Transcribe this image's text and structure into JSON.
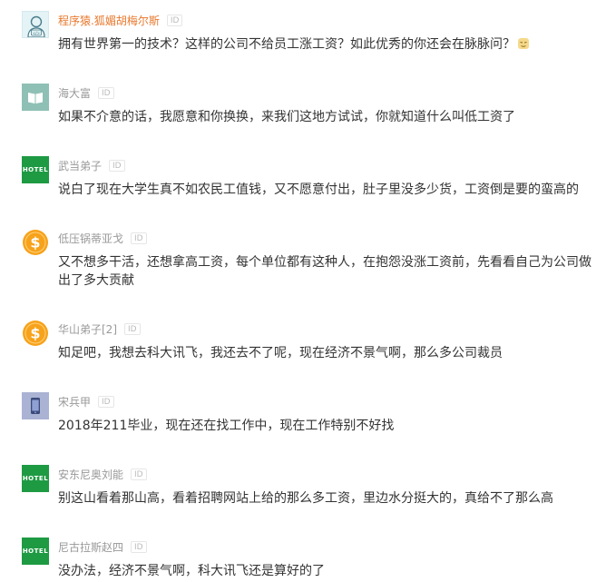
{
  "comments": [
    {
      "username": "程序猿.狐媚胡梅尔斯",
      "id_label": "ID",
      "avatar_icon": "coder-avatar-icon",
      "text": "拥有世界第一的技术？这样的公司不给员工涨工资？如此优秀的你还会在脉脉问？",
      "emoji_icon": "smug-emoji-icon"
    },
    {
      "username": "海大富",
      "id_label": "ID",
      "avatar_icon": "book-avatar-icon",
      "text": "如果不介意的话，我愿意和你换换，来我们这地方试试，你就知道什么叫低工资了"
    },
    {
      "username": "武当弟子",
      "id_label": "ID",
      "avatar_icon": "hotel-avatar-icon",
      "avatar_text": "HOTEL",
      "text": "说白了现在大学生真不如农民工值钱，又不愿意付出，肚子里没多少货，工资倒是要的蛮高的"
    },
    {
      "username": "低压锅蒂亚戈",
      "id_label": "ID",
      "avatar_icon": "dollar-coin-avatar-icon",
      "text": "又不想多干活，还想拿高工资，每个单位都有这种人，在抱怨没涨工资前，先看看自己为公司做出了多大贡献"
    },
    {
      "username": "华山弟子[2]",
      "id_label": "ID",
      "avatar_icon": "dollar-coin-avatar-icon",
      "text": "知足吧，我想去科大讯飞，我还去不了呢，现在经济不景气啊，那么多公司裁员"
    },
    {
      "username": "宋兵甲",
      "id_label": "ID",
      "avatar_icon": "phone-avatar-icon",
      "text": "2018年211毕业，现在还在找工作中，现在工作特别不好找"
    },
    {
      "username": "安东尼奥刘能",
      "id_label": "ID",
      "avatar_icon": "hotel-avatar-icon",
      "avatar_text": "HOTEL",
      "text": "别这山看着那山高，看着招聘网站上给的那么多工资，里边水分挺大的，真给不了那么高"
    },
    {
      "username": "尼古拉斯赵四",
      "id_label": "ID",
      "avatar_icon": "hotel-avatar-icon",
      "avatar_text": "HOTEL",
      "text": "没办法，经济不景气啊，科大讯飞还是算好的了"
    }
  ],
  "colors": {
    "username_default": "#999999",
    "username_highlight": "#e8782c",
    "text": "#333333",
    "hotel_green": "#1e9a43",
    "coin_orange": "#f7a21b"
  }
}
